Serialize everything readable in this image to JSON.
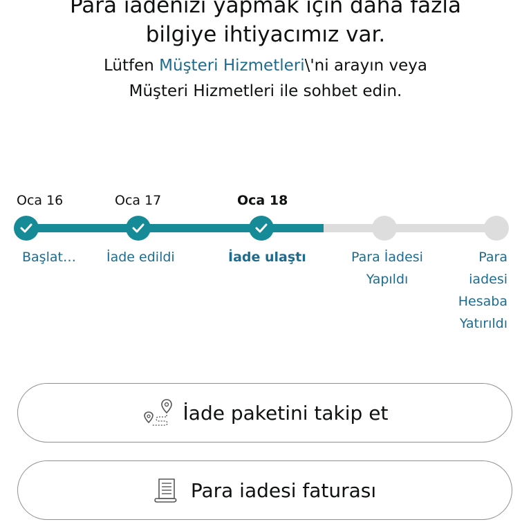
{
  "header": {
    "title_line1": "Para iadenizi yapmak için daha fazla",
    "title_line2": "bilgiye ihtiyacımız var.",
    "help_prefix": "Lütfen ",
    "help_link": "Müşteri Hizmetleri",
    "help_suffix": "\\'ni arayın veya",
    "help_line2": "Müşteri Hizmetleri ile sohbet edin."
  },
  "timeline": {
    "dates": [
      "Oca 16",
      "Oca 17",
      "Oca 18"
    ],
    "steps": [
      {
        "label": "Başlat…",
        "status": "done"
      },
      {
        "label": "İade edildi",
        "status": "done"
      },
      {
        "label": "İade ulaştı",
        "status": "current"
      },
      {
        "label_lines": [
          "Para İadesi",
          "Yapıldı"
        ],
        "status": "pending"
      },
      {
        "label_lines": [
          "Para",
          "iadesi",
          "Hesaba",
          "Yatırıldı"
        ],
        "status": "pending"
      }
    ],
    "colors": {
      "done": "#168a97",
      "pending": "#dddddd",
      "link": "#1e6b8f"
    }
  },
  "buttons": {
    "track_label": "İade paketini takip et",
    "track_icon": "route-map-pin-icon",
    "invoice_label": "Para iadesi faturası",
    "invoice_icon": "receipt-icon"
  }
}
